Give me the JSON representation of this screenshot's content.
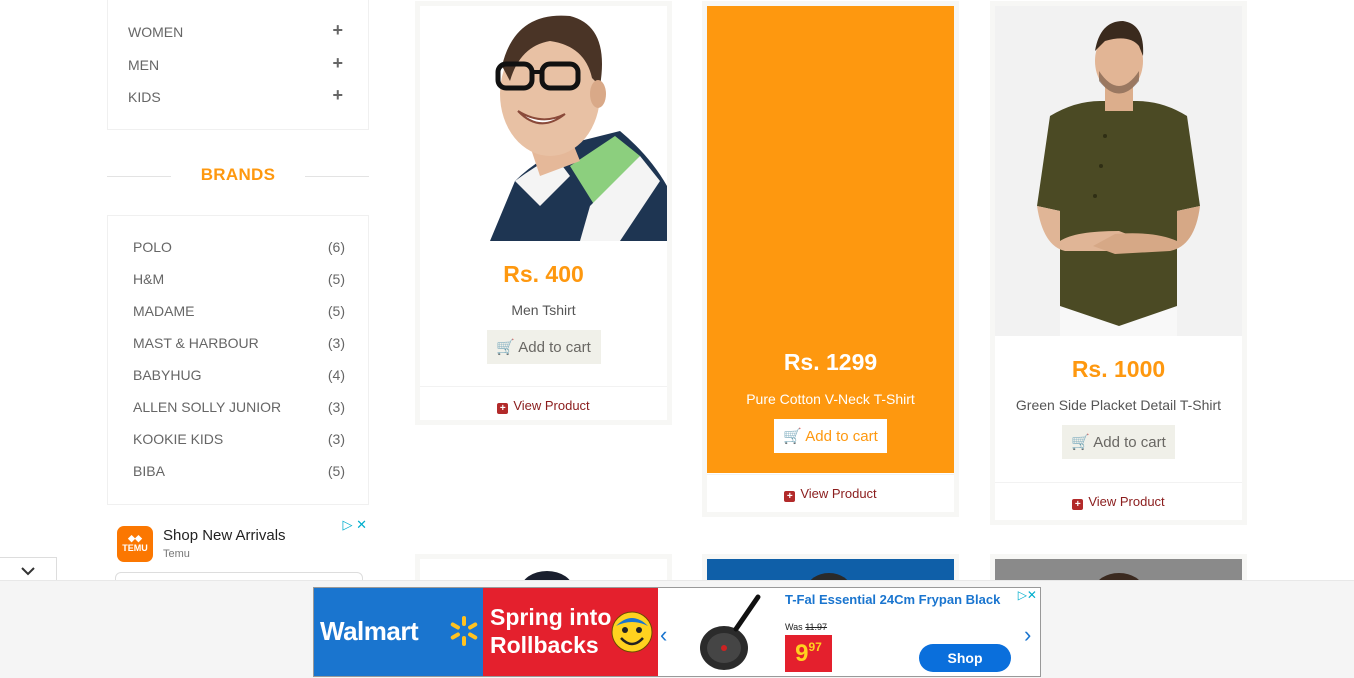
{
  "categories": [
    {
      "label": "WOMEN"
    },
    {
      "label": "MEN"
    },
    {
      "label": "KIDS"
    }
  ],
  "brands_title": "BRANDS",
  "brands": [
    {
      "name": "POLO",
      "count": "(6)"
    },
    {
      "name": "H&M",
      "count": "(5)"
    },
    {
      "name": "MADAME",
      "count": "(5)"
    },
    {
      "name": "MAST & HARBOUR",
      "count": "(3)"
    },
    {
      "name": "BABYHUG",
      "count": "(4)"
    },
    {
      "name": "ALLEN SOLLY JUNIOR",
      "count": "(3)"
    },
    {
      "name": "KOOKIE KIDS",
      "count": "(3)"
    },
    {
      "name": "BIBA",
      "count": "(5)"
    }
  ],
  "left_ad": {
    "logo_text": "TEMU",
    "title": "Shop New Arrivals",
    "subtitle": "Temu"
  },
  "products": [
    {
      "price": "Rs. 400",
      "name": "Men Tshirt",
      "cart_label": "Add to cart",
      "view_label": "View Product"
    },
    {
      "price": "Rs. 1299",
      "name": "Pure Cotton V-Neck T-Shirt",
      "cart_label": "Add to cart",
      "view_label": "View Product"
    },
    {
      "price": "Rs. 1000",
      "name": "Green Side Placket Detail T-Shirt",
      "cart_label": "Add to cart",
      "view_label": "View Product"
    }
  ],
  "bottom_ad": {
    "brand": "Walmart",
    "headline_1": "Spring into",
    "headline_2": "Rollbacks",
    "product_title": "T-Fal Essential 24Cm Frypan Black",
    "was_label": "Was",
    "was_price": "11.97",
    "price_main": "9",
    "price_cents": "97",
    "shop_label": "Shop"
  },
  "colors": {
    "accent": "#fe980f",
    "walmart_blue": "#1a75cf",
    "walmart_red": "#e4202d",
    "link_red": "#8b1d1d"
  }
}
